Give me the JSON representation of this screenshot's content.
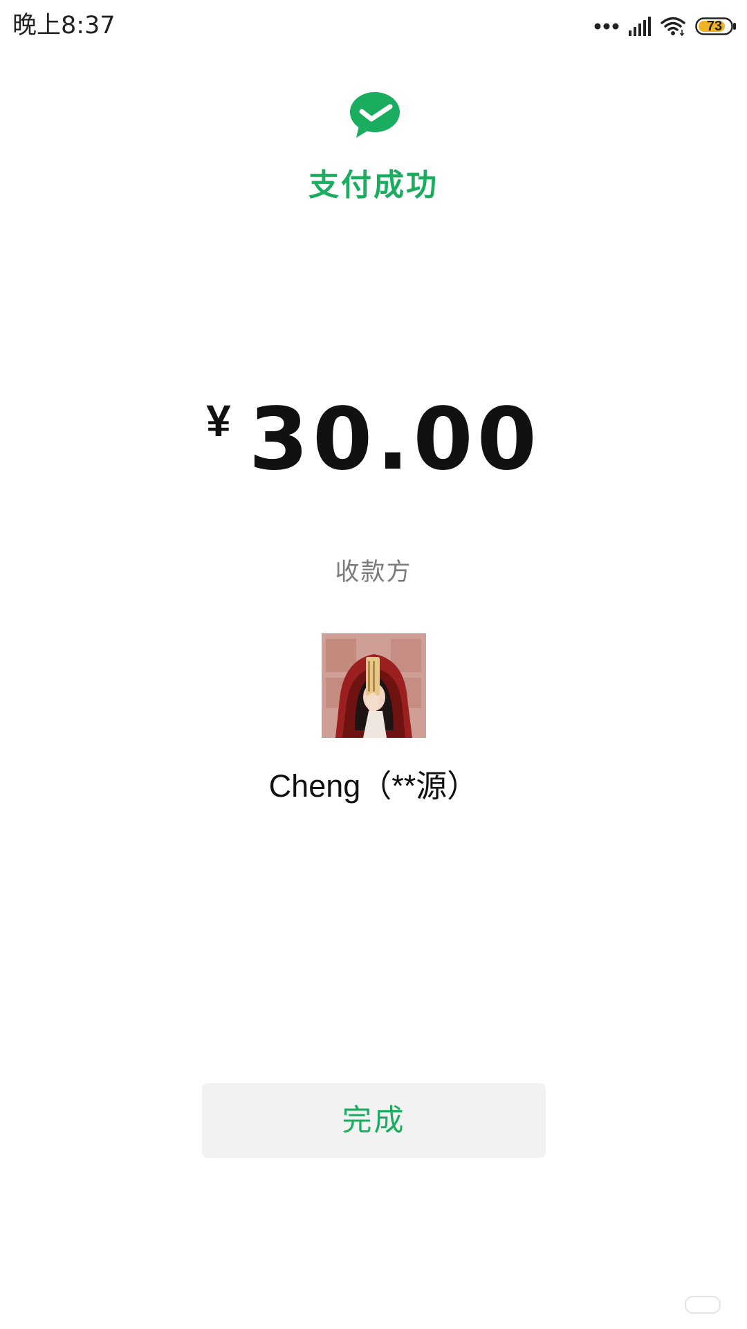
{
  "status_bar": {
    "time": "晚上8:37",
    "battery_level": "73",
    "icons": [
      "dots-icon",
      "signal-icon",
      "wifi-icon",
      "battery-icon"
    ]
  },
  "header": {
    "logo_icon": "wechat-pay-check-icon",
    "title": "支付成功"
  },
  "payment": {
    "currency_symbol": "¥",
    "amount": "30.00",
    "payee_label": "收款方",
    "payee_name": "Cheng（**源）"
  },
  "actions": {
    "done_label": "完成"
  },
  "colors": {
    "accent": "#1aad5f",
    "button_bg": "#f2f2f2",
    "secondary_text": "#7b7b7b",
    "battery_fill": "#f0b323"
  }
}
